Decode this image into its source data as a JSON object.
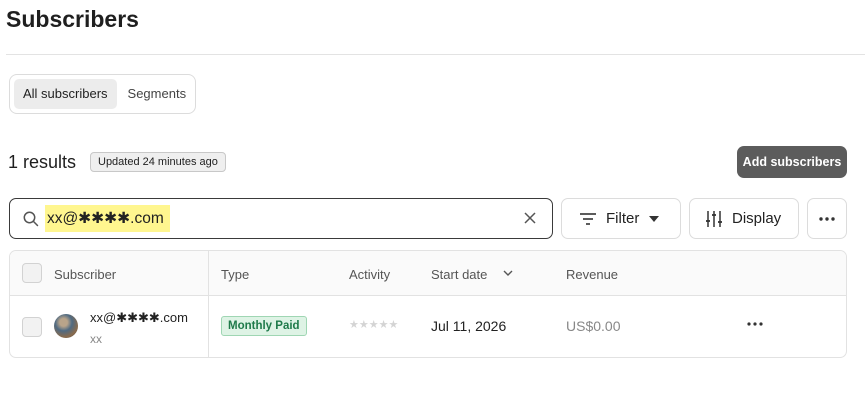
{
  "page": {
    "title": "Subscribers"
  },
  "tabs": [
    {
      "label": "All subscribers",
      "active": true
    },
    {
      "label": "Segments",
      "active": false
    }
  ],
  "results": {
    "count_label": "1 results",
    "updated_label": "Updated 24 minutes ago"
  },
  "actions": {
    "add_label": "Add subscribers"
  },
  "search": {
    "value": "xx@✱✱✱✱.com",
    "icon": "search-icon",
    "clear_icon": "close-icon"
  },
  "toolbar": {
    "filter_label": "Filter",
    "display_label": "Display"
  },
  "table": {
    "columns": [
      "Subscriber",
      "Type",
      "Activity",
      "Start date",
      "Revenue"
    ],
    "sort_column": "Start date",
    "rows": [
      {
        "email": "xx@✱✱✱✱.com",
        "name": "xx",
        "type": "Monthly Paid",
        "activity_stars": "★★★★★",
        "activity_level": 0,
        "start_date": "Jul 11, 2026",
        "revenue": "US$0.00"
      }
    ]
  },
  "colors": {
    "badge_text": "#1f7a4a",
    "badge_bg": "#def3e5",
    "highlight": "#fff68f",
    "primary_button": "#5c5c5c"
  }
}
